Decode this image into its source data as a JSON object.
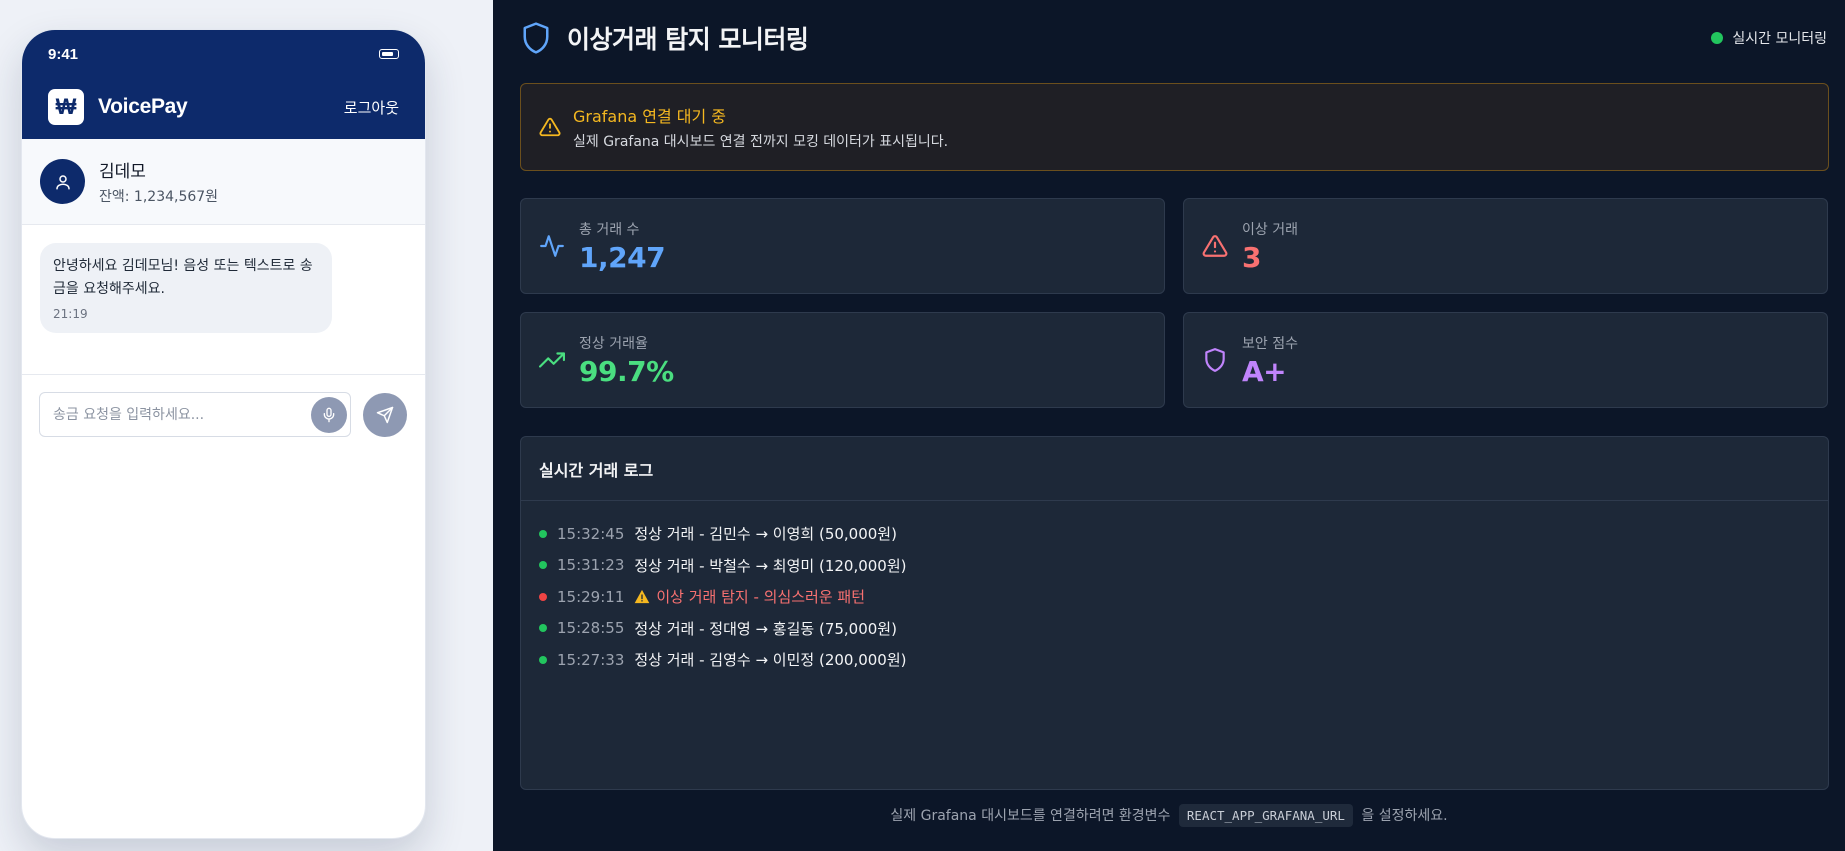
{
  "phone": {
    "status_time": "9:41",
    "brand_logo": "₩",
    "brand_name": "VoicePay",
    "logout_label": "로그아웃",
    "user": {
      "name": "김데모",
      "balance": "잔액: 1,234,567원"
    },
    "messages": [
      {
        "text": "안녕하세요 김데모님! 음성 또는 텍스트로 송금을 요청해주세요.",
        "time": "21:19"
      }
    ],
    "input": {
      "placeholder": "송금 요청을 입력하세요...",
      "value": ""
    },
    "icons": {
      "avatar": "user-icon",
      "mic": "microphone-icon",
      "send": "send-icon",
      "battery": "battery-icon"
    }
  },
  "dashboard": {
    "title": "이상거래 탐지 모니터링",
    "title_icon": "shield-icon",
    "live_status": "실시간 모니터링",
    "alert": {
      "title": "Grafana 연결 대기 중",
      "description": "실제 Grafana 대시보드 연결 전까지 모킹 데이터가 표시됩니다.",
      "icon": "warning-icon"
    },
    "stats": [
      {
        "label": "총 거래 수",
        "value": "1,247",
        "icon": "activity-icon",
        "color": "#60a5fa"
      },
      {
        "label": "이상 거래",
        "value": "3",
        "icon": "alert-triangle-icon",
        "color": "#f87171"
      },
      {
        "label": "정상 거래율",
        "value": "99.7%",
        "icon": "trending-up-icon",
        "color": "#4ade80"
      },
      {
        "label": "보안 점수",
        "value": "A+",
        "icon": "shield-icon",
        "color": "#c084fc"
      }
    ],
    "log": {
      "title": "실시간 거래 로그",
      "entries": [
        {
          "time": "15:32:45",
          "message": "정상 거래 - 김민수 → 이영희 (50,000원)",
          "status": "normal"
        },
        {
          "time": "15:31:23",
          "message": "정상 거래 - 박철수 → 최영미 (120,000원)",
          "status": "normal"
        },
        {
          "time": "15:29:11",
          "message": "이상 거래 탐지 - 의심스러운 패턴",
          "status": "anomaly"
        },
        {
          "time": "15:28:55",
          "message": "정상 거래 - 정대영 → 홍길동 (75,000원)",
          "status": "normal"
        },
        {
          "time": "15:27:33",
          "message": "정상 거래 - 김영수 → 이민정 (200,000원)",
          "status": "normal"
        }
      ]
    },
    "footer": {
      "before": "실제 Grafana 대시보드를 연결하려면 환경변수",
      "code": "REACT_APP_GRAFANA_URL",
      "after": "을 설정하세요."
    },
    "colors": {
      "normal": "#22c55e",
      "anomaly": "#ef4444",
      "warning": "#f5b820"
    }
  }
}
